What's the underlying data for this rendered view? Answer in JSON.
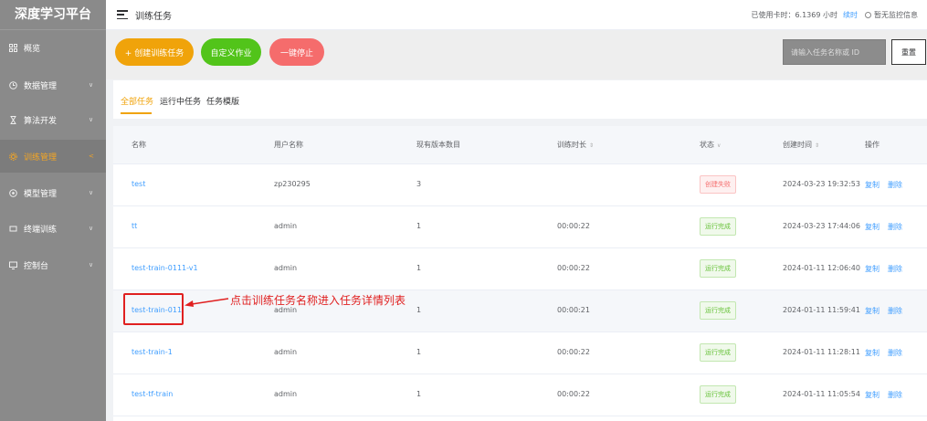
{
  "app": {
    "title": "深度学习平台"
  },
  "sidebar": {
    "items": [
      {
        "label": "概览",
        "icon": "grid-icon",
        "arrow": ""
      },
      {
        "label": "数据管理",
        "icon": "database-icon",
        "arrow": "∨"
      },
      {
        "label": "算法开发",
        "icon": "hourglass-icon",
        "arrow": "∨"
      },
      {
        "label": "训练管理",
        "icon": "gear-icon",
        "arrow": "<"
      },
      {
        "label": "模型管理",
        "icon": "cube-icon",
        "arrow": "∨"
      },
      {
        "label": "终端训练",
        "icon": "terminal-icon",
        "arrow": "∨"
      },
      {
        "label": "控制台",
        "icon": "monitor-icon",
        "arrow": "∨"
      }
    ]
  },
  "header": {
    "title": "训练任务",
    "usage": "已使用卡时：6.1369 小时",
    "recharge": "续时",
    "monitor": "暂无监控信息"
  },
  "toolbar": {
    "create_label": "+ 创建训练任务",
    "custom_label": "自定义作业",
    "stop_label": "一键停止",
    "search_placeholder": "请输入任务名称或 ID",
    "reset_label": "重置"
  },
  "tabs": [
    {
      "label": "全部任务"
    },
    {
      "label": "运行中任务"
    },
    {
      "label": "任务模版"
    }
  ],
  "table": {
    "headers": {
      "name": "名称",
      "user": "用户名称",
      "versions": "现有版本数目",
      "duration": "训练时长",
      "duration_sort": "⇕",
      "status": "状态",
      "status_filter": "∨",
      "created": "创建时间",
      "created_sort": "⇕",
      "ops": "操作"
    },
    "rows": [
      {
        "name": "test",
        "user": "zp230295",
        "versions": "3",
        "duration": "",
        "status": "创建失败",
        "created": "2024-03-23 19:32:53",
        "copy": "复制",
        "delete": "删除"
      },
      {
        "name": "tt",
        "user": "admin",
        "versions": "1",
        "duration": "00:00:22",
        "status": "运行完成",
        "created": "2024-03-23 17:44:06",
        "copy": "复制",
        "delete": "删除"
      },
      {
        "name": "test-train-0111-v1",
        "user": "admin",
        "versions": "1",
        "duration": "00:00:22",
        "status": "运行完成",
        "created": "2024-01-11 12:06:40",
        "copy": "复制",
        "delete": "删除"
      },
      {
        "name": "test-train-011",
        "user": "admin",
        "versions": "1",
        "duration": "00:00:21",
        "status": "运行完成",
        "created": "2024-01-11 11:59:41",
        "copy": "复制",
        "delete": "删除"
      },
      {
        "name": "test-train-1",
        "user": "admin",
        "versions": "1",
        "duration": "00:00:22",
        "status": "运行完成",
        "created": "2024-01-11 11:28:11",
        "copy": "复制",
        "delete": "删除"
      },
      {
        "name": "test-tf-train",
        "user": "admin",
        "versions": "1",
        "duration": "00:00:22",
        "status": "运行完成",
        "created": "2024-01-11 11:05:54",
        "copy": "复制",
        "delete": "删除"
      }
    ]
  },
  "annotation": {
    "text": "点击训练任务名称进入任务详情列表"
  },
  "colors": {
    "accent": "#f0a30a",
    "link": "#409eff",
    "success": "#67c23a",
    "danger": "#f56c6c",
    "annotation": "#e02020"
  }
}
